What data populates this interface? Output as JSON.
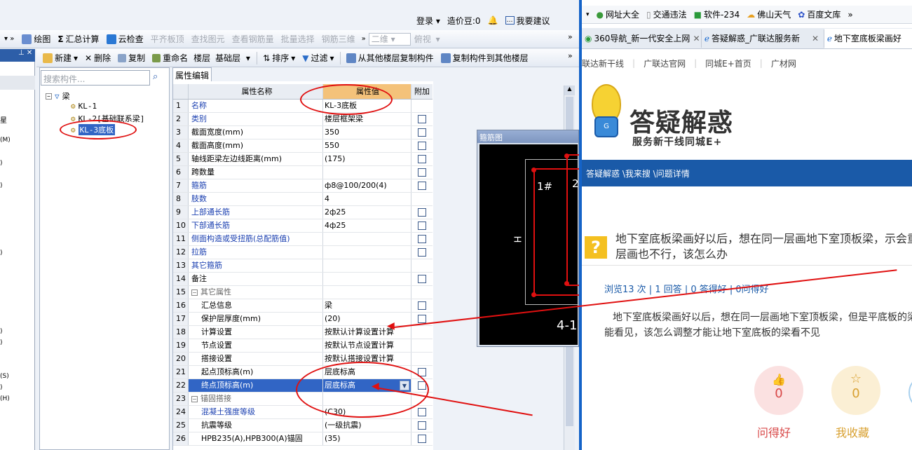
{
  "topbar": {
    "login": "登录",
    "zaojiadou": "造价豆:0",
    "suggest": "我要建议"
  },
  "toolbar1": {
    "draw": "绘图",
    "summary": "汇总计算",
    "cloud_check": "云检查",
    "flat_top": "平齐板顶",
    "find_elem": "查找图元",
    "view_rebar": "查看钢筋量",
    "batch_select": "批量选择",
    "rebar_3d": "钢筋三维",
    "view_mode": "二维",
    "view_angle": "俯视"
  },
  "toolbar2": {
    "new": "新建",
    "delete": "删除",
    "copy": "复制",
    "rename": "重命名",
    "floor_label": "楼层",
    "floor_value": "基础层",
    "sort": "排序",
    "filter": "过滤",
    "copy_from": "从其他楼层复制构件",
    "copy_to": "复制构件到其他楼层"
  },
  "search": {
    "placeholder": "搜索构件..."
  },
  "tree": {
    "root": "梁",
    "items": [
      "KL-1",
      "KL-2[基础联系梁]",
      "KL-3底板"
    ]
  },
  "left_panel": {
    "marks": [
      "星",
      "(M)",
      ")",
      ")",
      ")",
      ")",
      ")",
      "(S)",
      ")",
      "(H)"
    ]
  },
  "tab": {
    "label": "属性编辑"
  },
  "grid": {
    "headers": {
      "name": "属性名称",
      "value": "属性值",
      "extra": "附加"
    },
    "rows": [
      {
        "n": "1",
        "name": "名称",
        "value": "KL-3底板",
        "blue": true,
        "chk": false
      },
      {
        "n": "2",
        "name": "类别",
        "value": "楼层框架梁",
        "blue": true,
        "chk": true
      },
      {
        "n": "3",
        "name": "截面宽度(mm)",
        "value": "350",
        "blue": false,
        "chk": true
      },
      {
        "n": "4",
        "name": "截面高度(mm)",
        "value": "550",
        "blue": false,
        "chk": true
      },
      {
        "n": "5",
        "name": "轴线距梁左边线距离(mm)",
        "value": "(175)",
        "blue": false,
        "chk": true
      },
      {
        "n": "6",
        "name": "跨数量",
        "value": "",
        "blue": false,
        "chk": true
      },
      {
        "n": "7",
        "name": "箍筋",
        "value": "ф8@100/200(4)",
        "blue": true,
        "chk": true
      },
      {
        "n": "8",
        "name": "肢数",
        "value": "4",
        "blue": true,
        "chk": false
      },
      {
        "n": "9",
        "name": "上部通长筋",
        "value": "2ф25",
        "blue": true,
        "chk": true
      },
      {
        "n": "10",
        "name": "下部通长筋",
        "value": "4ф25",
        "blue": true,
        "chk": true
      },
      {
        "n": "11",
        "name": "侧面构造或受扭筋(总配筋值)",
        "value": "",
        "blue": true,
        "chk": true
      },
      {
        "n": "12",
        "name": "拉筋",
        "value": "",
        "blue": true,
        "chk": true
      },
      {
        "n": "13",
        "name": "其它箍筋",
        "value": "",
        "blue": true,
        "chk": false
      },
      {
        "n": "14",
        "name": "备注",
        "value": "",
        "blue": false,
        "chk": true
      },
      {
        "n": "15",
        "name": "其它属性",
        "value": "",
        "blue": false,
        "chk": false,
        "group": true
      },
      {
        "n": "16",
        "name": "汇总信息",
        "value": "梁",
        "blue": false,
        "chk": true,
        "sub": true
      },
      {
        "n": "17",
        "name": "保护层厚度(mm)",
        "value": "(20)",
        "blue": false,
        "chk": true,
        "sub": true
      },
      {
        "n": "18",
        "name": "计算设置",
        "value": "按默认计算设置计算",
        "blue": false,
        "chk": false,
        "sub": true
      },
      {
        "n": "19",
        "name": "节点设置",
        "value": "按默认节点设置计算",
        "blue": false,
        "chk": false,
        "sub": true
      },
      {
        "n": "20",
        "name": "搭接设置",
        "value": "按默认搭接设置计算",
        "blue": false,
        "chk": false,
        "sub": true
      },
      {
        "n": "21",
        "name": "起点顶标高(m)",
        "value": "层底标高",
        "blue": false,
        "chk": true,
        "sub": true
      },
      {
        "n": "22",
        "name": "终点顶标高(m)",
        "value": "层底标高",
        "blue": false,
        "chk": true,
        "sub": true,
        "selected": true
      },
      {
        "n": "23",
        "name": "锚固搭接",
        "value": "",
        "blue": false,
        "chk": false,
        "group": true
      },
      {
        "n": "24",
        "name": "混凝土强度等级",
        "value": "(C30)",
        "blue": true,
        "chk": true,
        "sub": true
      },
      {
        "n": "25",
        "name": "抗震等级",
        "value": "(一级抗震)",
        "blue": false,
        "chk": true,
        "sub": true
      },
      {
        "n": "26",
        "name": "HPB235(A),HPB300(A)锚固",
        "value": "(35)",
        "blue": false,
        "chk": true,
        "sub": true
      }
    ]
  },
  "stirrup": {
    "title": "箍筋图",
    "label_h": "H",
    "label_1": "1#",
    "label_2": "2",
    "label_bottom": "4-1"
  },
  "browser": {
    "favorites": [
      "网址大全",
      "交通违法",
      "软件-234",
      "佛山天气",
      "百度文库"
    ],
    "tabs": [
      "360导航_新一代安全上网",
      "答疑解惑_广联达服务新",
      "地下室底板梁画好"
    ],
    "nav_links": [
      "联达新干线",
      "广联达官网",
      "同城E+首页",
      "广材网"
    ],
    "brand_title": "答疑解惑",
    "brand_sub": "服务新干线同城E+",
    "breadcrumb": "答疑解惑 \\我来搜 \\问题详情",
    "question_title": "地下室底板梁画好以后，想在同一层画地下室顶板梁，示会重叠，分层画也不行，该怎么办",
    "stats": "浏览13 次 | 1 回答 | 0 答得好 | 0问得好",
    "body": "地下室底板梁画好以后，想在同一层画地下室顶板梁，但是平底板的梁还是能看见，该怎么调整才能让地下室底板的梁看不见",
    "good_count": "0",
    "fav_count": "0",
    "good_label": "问得好",
    "fav_label": "我收藏",
    "mascot_letter": "G"
  },
  "colors": {
    "annotation": "#e01010",
    "selected": "#3165c5",
    "browser_blue": "#1463c8"
  }
}
